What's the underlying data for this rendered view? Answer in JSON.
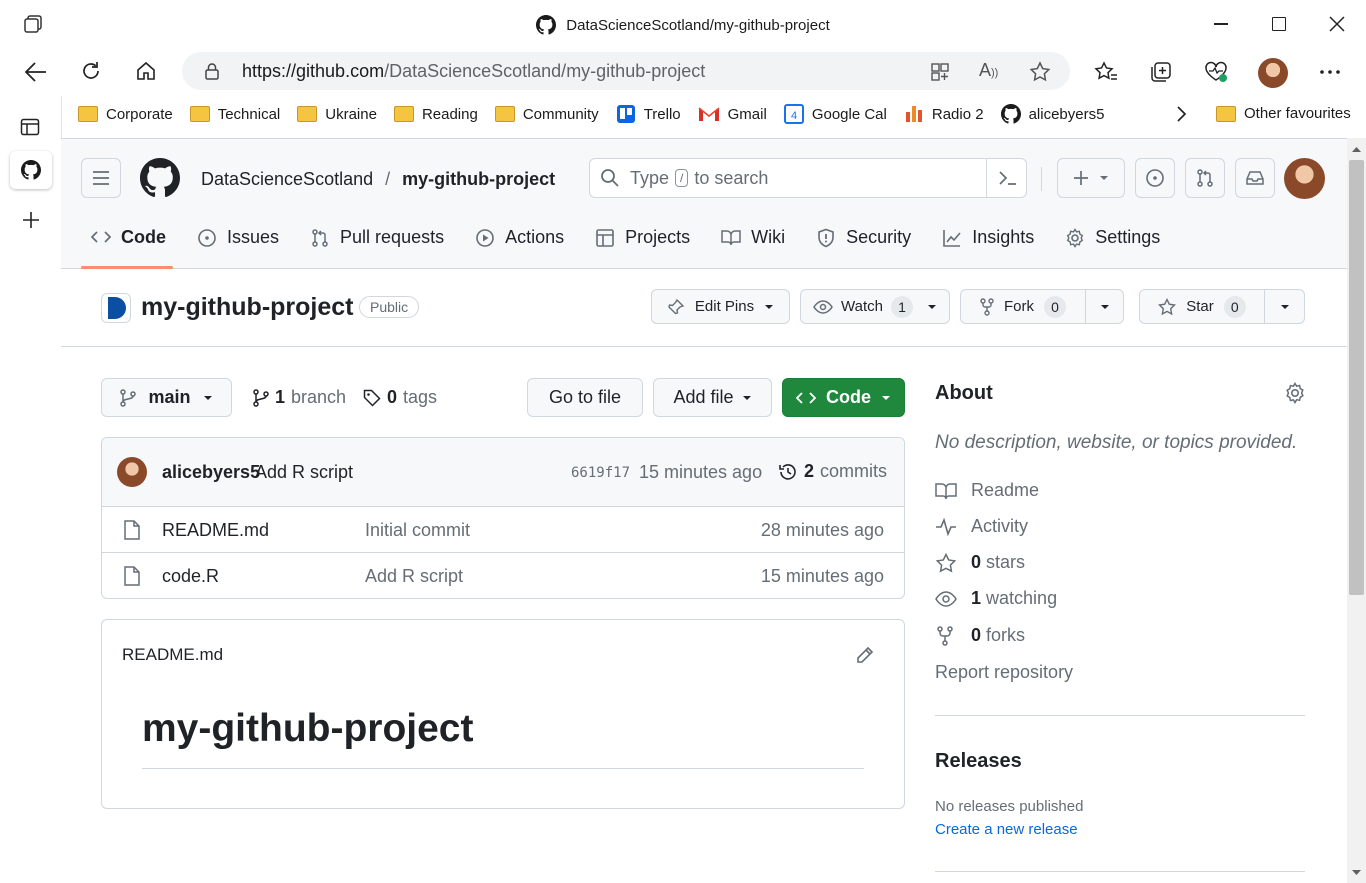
{
  "window": {
    "title": "DataScienceScotland/my-github-project"
  },
  "browser": {
    "url_host": "https://github.com",
    "url_path": "/DataScienceScotland/my-github-project",
    "favorites": [
      {
        "label": "Corporate",
        "icon": "folder-icon"
      },
      {
        "label": "Technical",
        "icon": "folder-icon"
      },
      {
        "label": "Ukraine",
        "icon": "folder-icon"
      },
      {
        "label": "Reading",
        "icon": "folder-icon"
      },
      {
        "label": "Community",
        "icon": "folder-icon"
      },
      {
        "label": "Trello",
        "icon": "trello-icon"
      },
      {
        "label": "Gmail",
        "icon": "gmail-icon"
      },
      {
        "label": "Google Cal",
        "icon": "calendar-icon"
      },
      {
        "label": "Radio 2",
        "icon": "radio-icon"
      },
      {
        "label": "alicebyers5",
        "icon": "github-icon"
      }
    ],
    "other_favourites": "Other favourites"
  },
  "repo": {
    "owner": "DataScienceScotland",
    "separator": "/",
    "name": "my-github-project",
    "visibility": "Public",
    "search_placeholder_pre": "Type",
    "search_key": "/",
    "search_placeholder_post": "to search"
  },
  "tabs": [
    {
      "label": "Code",
      "icon": "code-icon",
      "active": true
    },
    {
      "label": "Issues",
      "icon": "issue-icon"
    },
    {
      "label": "Pull requests",
      "icon": "pull-request-icon"
    },
    {
      "label": "Actions",
      "icon": "play-icon"
    },
    {
      "label": "Projects",
      "icon": "table-icon"
    },
    {
      "label": "Wiki",
      "icon": "book-icon"
    },
    {
      "label": "Security",
      "icon": "shield-icon"
    },
    {
      "label": "Insights",
      "icon": "graph-icon"
    },
    {
      "label": "Settings",
      "icon": "gear-icon"
    }
  ],
  "actions": {
    "edit_pins": "Edit Pins",
    "watch": "Watch",
    "watch_count": "1",
    "fork": "Fork",
    "fork_count": "0",
    "star": "Star",
    "star_count": "0"
  },
  "toolbar": {
    "branch": "main",
    "branch_count": "1",
    "branch_label": "branch",
    "tag_count": "0",
    "tag_label": "tags",
    "go_to_file": "Go to file",
    "add_file": "Add file",
    "code": "Code"
  },
  "commit": {
    "author": "alicebyers5",
    "message": "Add R script",
    "sha": "6619f17",
    "time": "15 minutes ago",
    "count": "2",
    "count_label": "commits"
  },
  "files": [
    {
      "name": "README.md",
      "message": "Initial commit",
      "time": "28 minutes ago"
    },
    {
      "name": "code.R",
      "message": "Add R script",
      "time": "15 minutes ago"
    }
  ],
  "readme": {
    "filename": "README.md",
    "heading": "my-github-project"
  },
  "about": {
    "title": "About",
    "description": "No description, website, or topics provided.",
    "readme": "Readme",
    "activity": "Activity",
    "stars_count": "0",
    "stars_label": "stars",
    "watching_count": "1",
    "watching_label": "watching",
    "forks_count": "0",
    "forks_label": "forks",
    "report": "Report repository"
  },
  "releases": {
    "title": "Releases",
    "none": "No releases published",
    "create": "Create a new release"
  },
  "colors": {
    "accent_green": "#1f883d",
    "link_blue": "#0969da",
    "active_tab": "#fd8c73"
  }
}
